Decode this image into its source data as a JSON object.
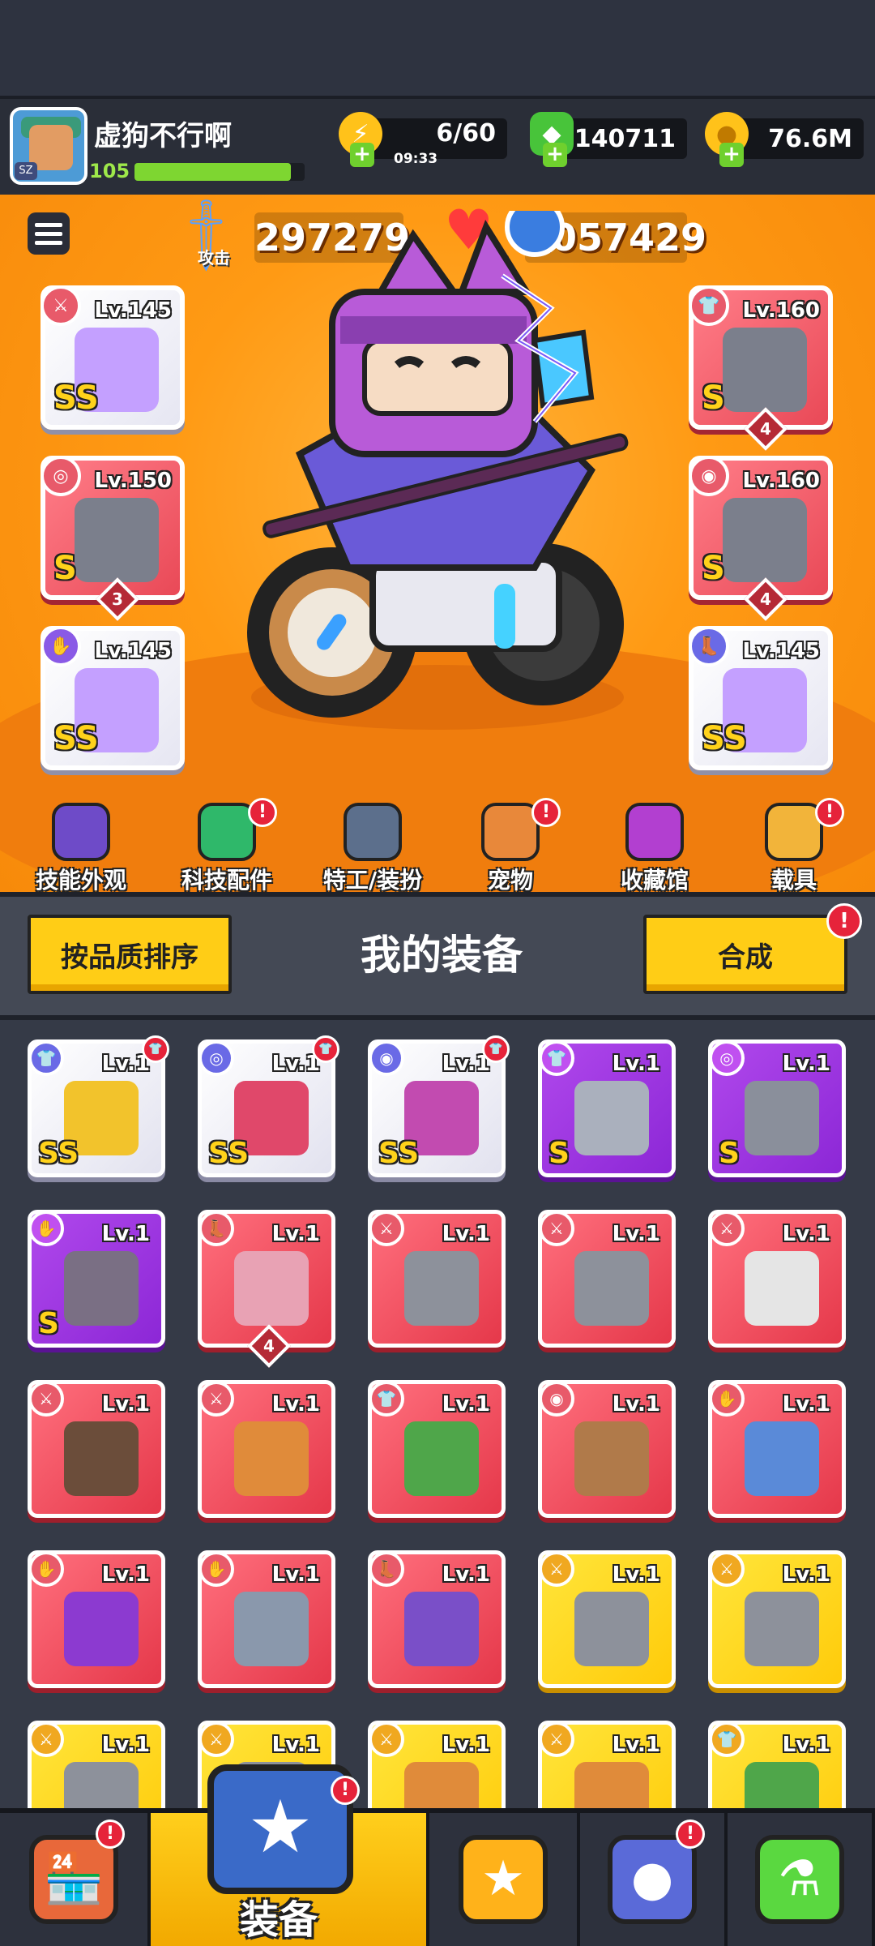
{
  "player": {
    "name": "虚狗不行啊",
    "level": "105",
    "avatar_badge": "SZ",
    "xp_fraction": 0.92
  },
  "resources": {
    "energy": "6/60",
    "energy_timer": "09:33",
    "gems": "140711",
    "coins": "76.6M"
  },
  "stats": {
    "attack_label": "攻击",
    "attack_value": "297279",
    "hp_label": "生命",
    "hp_value": "1057429"
  },
  "equipped": {
    "left": [
      {
        "level": "Lv.145",
        "grade": "SS",
        "slot": "weapon",
        "rarity": "white",
        "stars": ""
      },
      {
        "level": "Lv.150",
        "grade": "S",
        "slot": "necklace",
        "rarity": "red",
        "stars": "3"
      },
      {
        "level": "Lv.145",
        "grade": "SS",
        "slot": "glove",
        "rarity": "white",
        "stars": ""
      }
    ],
    "right": [
      {
        "level": "Lv.160",
        "grade": "S",
        "slot": "armor",
        "rarity": "red",
        "stars": "4"
      },
      {
        "level": "Lv.160",
        "grade": "S",
        "slot": "belt",
        "rarity": "red",
        "stars": "4"
      },
      {
        "level": "Lv.145",
        "grade": "SS",
        "slot": "boots",
        "rarity": "white",
        "stars": ""
      }
    ]
  },
  "features": [
    {
      "label": "技能外观",
      "alert": false,
      "icon": "skill-skin-icon",
      "color": "#6e4bc8"
    },
    {
      "label": "科技配件",
      "alert": true,
      "icon": "tech-part-icon",
      "color": "#2fb86a"
    },
    {
      "label": "特工/装扮",
      "alert": false,
      "icon": "agent-icon",
      "color": "#5c6f8c"
    },
    {
      "label": "宠物",
      "alert": true,
      "icon": "pet-icon",
      "color": "#e8883a"
    },
    {
      "label": "收藏馆",
      "alert": false,
      "icon": "collection-icon",
      "color": "#b23fd0"
    },
    {
      "label": "载具",
      "alert": true,
      "icon": "vehicle-icon",
      "color": "#f2b43a"
    }
  ],
  "equipment_panel": {
    "sort_label": "按品质排序",
    "title": "我的装备",
    "merge_label": "合成",
    "merge_alert": "!"
  },
  "inventory": [
    {
      "level": "Lv.1",
      "rarity": "white",
      "grade": "SS",
      "slot": "armor",
      "new": true,
      "stars": "",
      "art": "#f2c32c"
    },
    {
      "level": "Lv.1",
      "rarity": "white",
      "grade": "SS",
      "slot": "necklace",
      "new": true,
      "stars": "",
      "art": "#e0486a"
    },
    {
      "level": "Lv.1",
      "rarity": "white",
      "grade": "SS",
      "slot": "belt",
      "new": true,
      "stars": "",
      "art": "#c24bb0"
    },
    {
      "level": "Lv.1",
      "rarity": "purple",
      "grade": "S",
      "slot": "armor",
      "new": false,
      "stars": "",
      "art": "#aab0bd"
    },
    {
      "level": "Lv.1",
      "rarity": "purple",
      "grade": "S",
      "slot": "necklace",
      "new": false,
      "stars": "",
      "art": "#8a8f9b"
    },
    {
      "level": "Lv.1",
      "rarity": "purple",
      "grade": "S",
      "slot": "glove",
      "new": false,
      "stars": "",
      "art": "#7a6f84"
    },
    {
      "level": "Lv.1",
      "rarity": "red",
      "grade": "",
      "slot": "boots",
      "new": false,
      "stars": "4",
      "art": "#e8a2b4"
    },
    {
      "level": "Lv.1",
      "rarity": "red",
      "grade": "",
      "slot": "weapon",
      "new": false,
      "stars": "",
      "art": "#8d919b"
    },
    {
      "level": "Lv.1",
      "rarity": "red",
      "grade": "",
      "slot": "weapon",
      "new": false,
      "stars": "",
      "art": "#8d919b"
    },
    {
      "level": "Lv.1",
      "rarity": "red",
      "grade": "",
      "slot": "weapon",
      "new": false,
      "stars": "",
      "art": "#e5e5e5"
    },
    {
      "level": "Lv.1",
      "rarity": "red",
      "grade": "",
      "slot": "weapon",
      "new": false,
      "stars": "",
      "art": "#6b4d3a"
    },
    {
      "level": "Lv.1",
      "rarity": "red",
      "grade": "",
      "slot": "weapon",
      "new": false,
      "stars": "",
      "art": "#e08b3a"
    },
    {
      "level": "Lv.1",
      "rarity": "red",
      "grade": "",
      "slot": "armor",
      "new": false,
      "stars": "",
      "art": "#4fa64a"
    },
    {
      "level": "Lv.1",
      "rarity": "red",
      "grade": "",
      "slot": "belt",
      "new": false,
      "stars": "",
      "art": "#b07a4a"
    },
    {
      "level": "Lv.1",
      "rarity": "red",
      "grade": "",
      "slot": "glove",
      "new": false,
      "stars": "",
      "art": "#5a8ad8"
    },
    {
      "level": "Lv.1",
      "rarity": "red",
      "grade": "",
      "slot": "glove",
      "new": false,
      "stars": "",
      "art": "#8c3ad0"
    },
    {
      "level": "Lv.1",
      "rarity": "red",
      "grade": "",
      "slot": "glove",
      "new": false,
      "stars": "",
      "art": "#8a98ac"
    },
    {
      "level": "Lv.1",
      "rarity": "red",
      "grade": "",
      "slot": "boots",
      "new": false,
      "stars": "",
      "art": "#7a4fc8"
    },
    {
      "level": "Lv.1",
      "rarity": "yellow",
      "grade": "",
      "slot": "weapon",
      "new": false,
      "stars": "",
      "art": "#8d919b"
    },
    {
      "level": "Lv.1",
      "rarity": "yellow",
      "grade": "",
      "slot": "weapon",
      "new": false,
      "stars": "",
      "art": "#8d919b"
    },
    {
      "level": "Lv.1",
      "rarity": "yellow",
      "grade": "",
      "slot": "weapon",
      "new": false,
      "stars": "",
      "art": "#8d919b"
    },
    {
      "level": "Lv.1",
      "rarity": "yellow",
      "grade": "",
      "slot": "weapon",
      "new": false,
      "stars": "",
      "art": "#8d919b"
    },
    {
      "level": "Lv.1",
      "rarity": "yellow",
      "grade": "",
      "slot": "weapon",
      "new": false,
      "stars": "",
      "art": "#e08b3a"
    },
    {
      "level": "Lv.1",
      "rarity": "yellow",
      "grade": "",
      "slot": "weapon",
      "new": false,
      "stars": "",
      "art": "#e08b3a"
    },
    {
      "level": "Lv.1",
      "rarity": "yellow",
      "grade": "",
      "slot": "armor",
      "new": false,
      "stars": "",
      "art": "#4fa64a"
    }
  ],
  "bottom_nav": [
    {
      "name": "shop",
      "label": "",
      "icon": "shop-icon",
      "alert": true,
      "active": false
    },
    {
      "name": "equipment",
      "label": "装备",
      "icon": "equipment-icon",
      "alert": true,
      "active": true
    },
    {
      "name": "battle",
      "label": "",
      "icon": "battle-star-icon",
      "alert": false,
      "active": false
    },
    {
      "name": "egg",
      "label": "",
      "icon": "egg-icon",
      "alert": true,
      "active": false
    },
    {
      "name": "lab",
      "label": "",
      "icon": "lab-icon",
      "alert": false,
      "active": false
    }
  ],
  "colors": {
    "hero_bg": "#ff9a14",
    "accent_yellow": "#ffcd16",
    "alert_red": "#e6233a",
    "xp_green": "#7ed631"
  }
}
